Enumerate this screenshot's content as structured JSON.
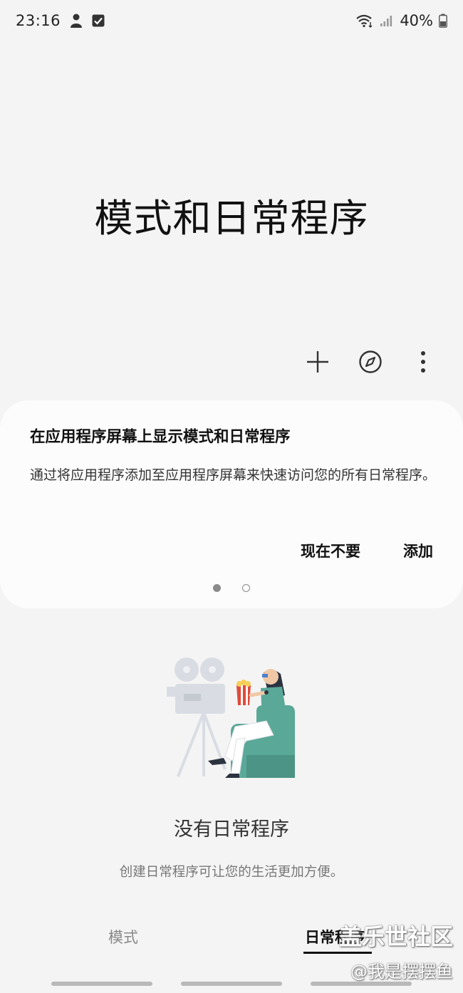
{
  "status_bar": {
    "time": "23:16",
    "battery": "40%",
    "icons": [
      "profile-icon",
      "checkbox-notification-icon",
      "wifi-icon",
      "signal-icon",
      "battery-icon"
    ]
  },
  "header": {
    "title": "模式和日常程序"
  },
  "toolbar": {
    "icons": [
      "add-icon",
      "compass-icon",
      "more-options-icon"
    ]
  },
  "card": {
    "title": "在应用程序屏幕上显示模式和日常程序",
    "body": "通过将应用程序添加至应用程序屏幕来快速访问您的所有日常程序。",
    "dismiss_label": "现在不要",
    "add_label": "添加",
    "page_count": 2,
    "current_page": 1
  },
  "empty_state": {
    "title": "没有日常程序",
    "subtitle": "创建日常程序可让您的生活更加方便。",
    "illustration": "movie-projector-illustration"
  },
  "bottom_tabs": {
    "modes_label": "模式",
    "routines_label": "日常程序",
    "active": "routines"
  },
  "watermark": {
    "line1": "盖乐世社区",
    "line2": "@我是摆摆鱼"
  },
  "colors": {
    "background": "#f4f4f4",
    "card": "#fcfcfc",
    "illustration_teal": "#5aa898"
  }
}
